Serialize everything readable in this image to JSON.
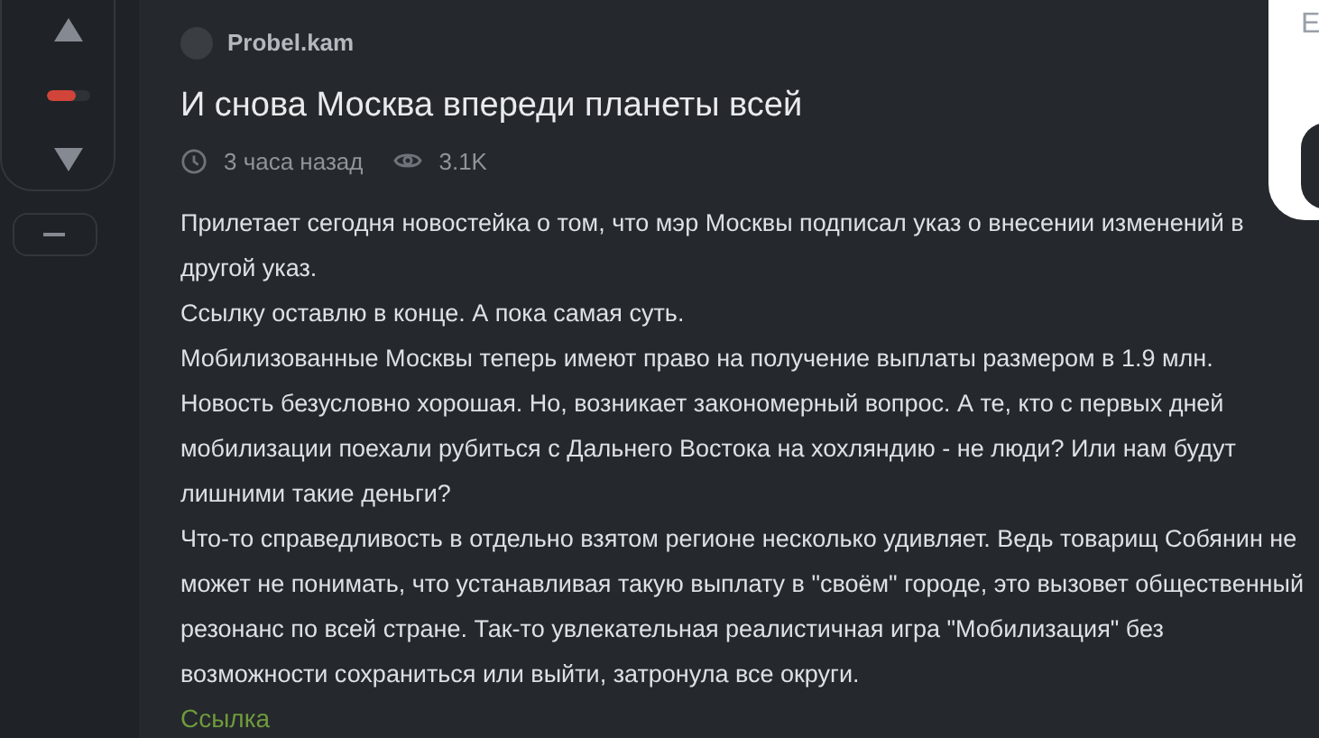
{
  "vote": {
    "level": 0.65
  },
  "post": {
    "author": "Probel.kam",
    "title": "И снова Москва впереди планеты всей",
    "time": "3 часа назад",
    "views": "3.1K",
    "paragraphs": [
      "Прилетает сегодня новостейка о том, что мэр Москвы подписал указ о внесении изменений в другой указ.",
      "Ссылку оставлю в конце. А пока самая суть.",
      "Мобилизованные Москвы теперь имеют право на получение выплаты размером в 1.9 млн. Новость безусловно хорошая. Но, возникает закономерный вопрос. А те, кто с первых дней мобилизации поехали рубиться с Дальнего Востока на хохляндию - не люди? Или нам будут лишними такие деньги?",
      "Что-то справедливость в отдельно взятом регионе несколько удивляет. Ведь товарищ Собянин не может не понимать, что устанавливая такую выплату в \"своём\" городе, это вызовет общественный резонанс по всей стране. Так-то увлекательная реалистичная игра \"Мобилизация\" без возможности сохраниться или выйти, затронула все округи."
    ],
    "link": "Ссылка"
  },
  "popup": {
    "text": "E"
  }
}
